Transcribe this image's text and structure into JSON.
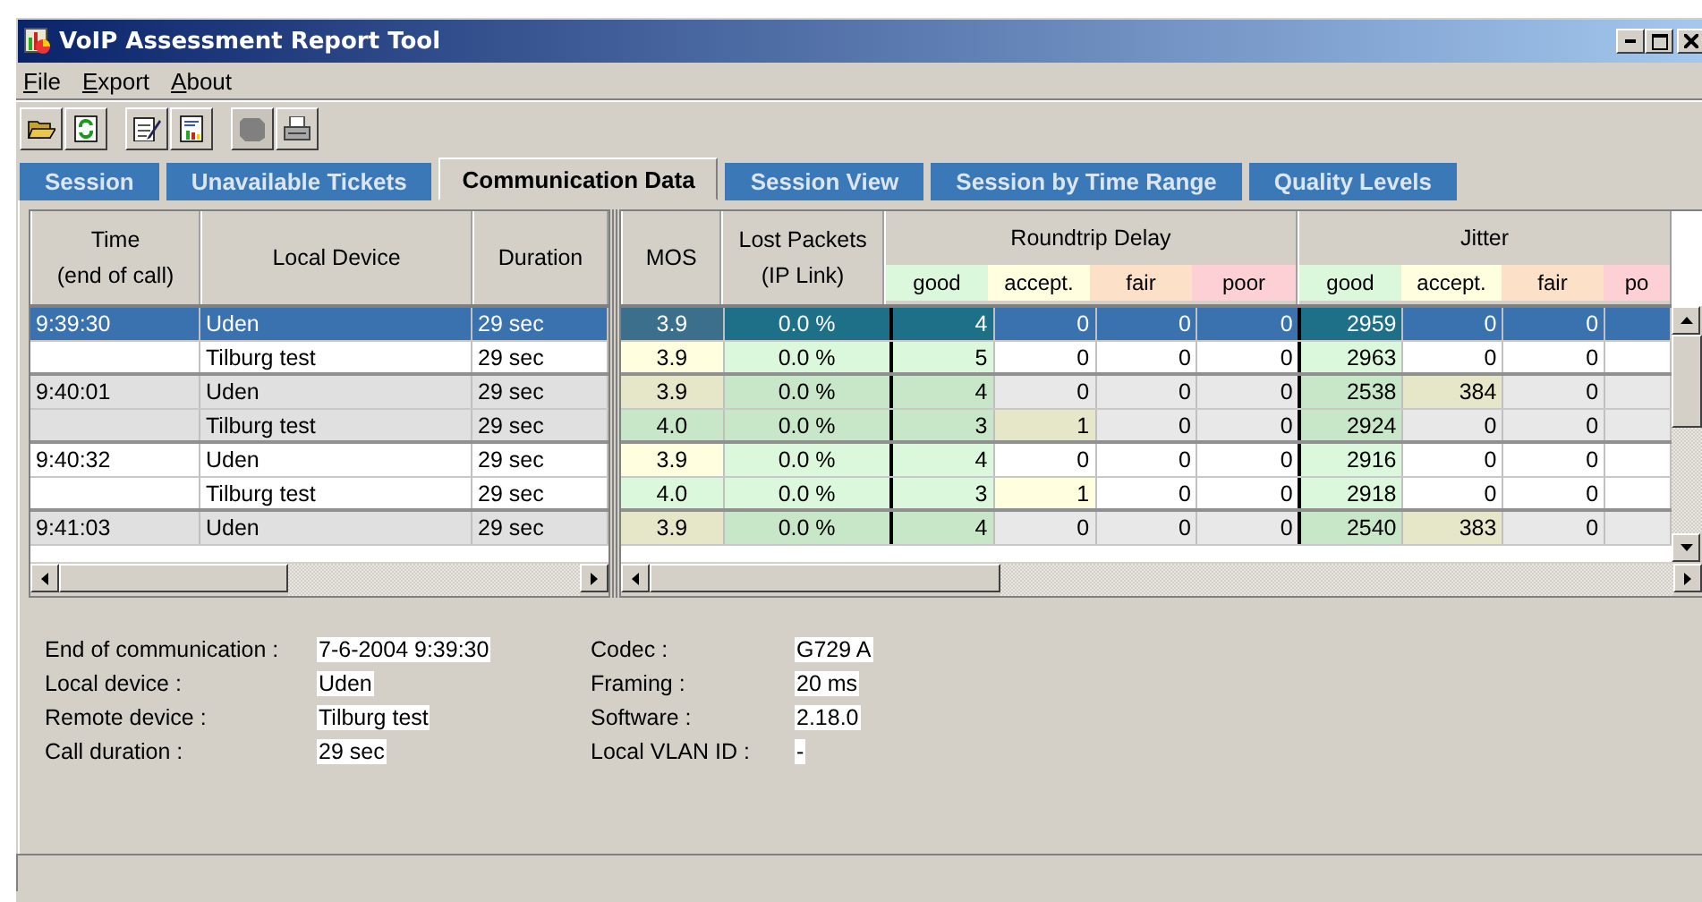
{
  "window": {
    "title": "VoIP Assessment Report Tool"
  },
  "menu": [
    "File",
    "Export",
    "About"
  ],
  "toolbar": [
    {
      "kind": "open",
      "disabled": false
    },
    {
      "kind": "refresh",
      "disabled": false
    },
    {
      "kind": "edit",
      "disabled": false
    },
    {
      "kind": "report",
      "disabled": false
    },
    {
      "kind": "blank",
      "disabled": true
    },
    {
      "kind": "print",
      "disabled": false
    }
  ],
  "tabs": [
    {
      "label": "Session",
      "selected": false
    },
    {
      "label": "Unavailable Tickets",
      "selected": false
    },
    {
      "label": "Communication Data",
      "selected": true
    },
    {
      "label": "Session View",
      "selected": false
    },
    {
      "label": "Session by Time Range",
      "selected": false
    },
    {
      "label": "Quality Levels",
      "selected": false
    }
  ],
  "table": {
    "left_columns": [
      {
        "label": "Time",
        "note": "(end of call)"
      },
      {
        "label": "Local Device"
      },
      {
        "label": "Duration"
      }
    ],
    "right_columns": [
      {
        "label": "MOS"
      },
      {
        "label": "Lost Packets",
        "note": "(IP Link)"
      }
    ],
    "groups": [
      {
        "label": "Roundtrip Delay",
        "subs": [
          {
            "label": "good",
            "color": "#dcf8dc"
          },
          {
            "label": "accept.",
            "color": "#ffffe0"
          },
          {
            "label": "fair",
            "color": "#fde0c8"
          },
          {
            "label": "poor",
            "color": "#fcd0d4"
          }
        ]
      },
      {
        "label": "Jitter",
        "subs": [
          {
            "label": "good",
            "color": "#dcf8dc"
          },
          {
            "label": "accept.",
            "color": "#ffffe0"
          },
          {
            "label": "fair",
            "color": "#fde0c8"
          },
          {
            "label": "po",
            "color": "#fcd0d4"
          }
        ]
      }
    ],
    "rows": [
      {
        "time": "9:39:30",
        "device": "Uden",
        "duration": "29 sec",
        "selected": true,
        "shaded": false,
        "mos": {
          "text": "3.9",
          "color": "#3b6f8c"
        },
        "lost": {
          "text": "0.0 %",
          "color": "#1e7088"
        },
        "delay": [
          {
            "text": "4",
            "color": "#1e7088"
          },
          {
            "text": "0",
            "color": "#3a72b0"
          },
          {
            "text": "0",
            "color": "#3a72b0"
          },
          {
            "text": "0",
            "color": "#3a72b0"
          }
        ],
        "jitter": [
          {
            "text": "2959",
            "color": "#1e7088"
          },
          {
            "text": "0",
            "color": "#3a72b0"
          },
          {
            "text": "0",
            "color": "#3a72b0"
          }
        ]
      },
      {
        "device": "Tilburg test",
        "duration": "29 sec",
        "selected": false,
        "shaded": false,
        "mos": {
          "text": "3.9",
          "color": "#ffffe0"
        },
        "lost": {
          "text": "0.0 %",
          "color": "#dcf8dc"
        },
        "delay": [
          {
            "text": "5",
            "color": "#dcf8dc"
          },
          {
            "text": "0",
            "color": "#ffffff"
          },
          {
            "text": "0",
            "color": "#ffffff"
          },
          {
            "text": "0",
            "color": "#ffffff"
          }
        ],
        "jitter": [
          {
            "text": "2963",
            "color": "#dcf8dc"
          },
          {
            "text": "0",
            "color": "#ffffff"
          },
          {
            "text": "0",
            "color": "#ffffff"
          }
        ]
      },
      {
        "time": "9:40:01",
        "device": "Uden",
        "duration": "29 sec",
        "selected": false,
        "shaded": true,
        "mos": {
          "text": "3.9",
          "color": "#e6e6c8"
        },
        "lost": {
          "text": "0.0 %",
          "color": "#c8e6c8"
        },
        "delay": [
          {
            "text": "4",
            "color": "#c8e6c8"
          },
          {
            "text": "0",
            "color": "#e8e8e8"
          },
          {
            "text": "0",
            "color": "#e8e8e8"
          },
          {
            "text": "0",
            "color": "#e8e8e8"
          }
        ],
        "jitter": [
          {
            "text": "2538",
            "color": "#c8e6c8"
          },
          {
            "text": "384",
            "color": "#e6e6c8"
          },
          {
            "text": "0",
            "color": "#e8e8e8"
          }
        ]
      },
      {
        "device": "Tilburg test",
        "duration": "29 sec",
        "selected": false,
        "shaded": true,
        "mos": {
          "text": "4.0",
          "color": "#c8e6c8"
        },
        "lost": {
          "text": "0.0 %",
          "color": "#c8e6c8"
        },
        "delay": [
          {
            "text": "3",
            "color": "#c8e6c8"
          },
          {
            "text": "1",
            "color": "#e6e6c8"
          },
          {
            "text": "0",
            "color": "#e8e8e8"
          },
          {
            "text": "0",
            "color": "#e8e8e8"
          }
        ],
        "jitter": [
          {
            "text": "2924",
            "color": "#c8e6c8"
          },
          {
            "text": "0",
            "color": "#e8e8e8"
          },
          {
            "text": "0",
            "color": "#e8e8e8"
          }
        ]
      },
      {
        "time": "9:40:32",
        "device": "Uden",
        "duration": "29 sec",
        "selected": false,
        "shaded": false,
        "mos": {
          "text": "3.9",
          "color": "#ffffe0"
        },
        "lost": {
          "text": "0.0 %",
          "color": "#dcf8dc"
        },
        "delay": [
          {
            "text": "4",
            "color": "#dcf8dc"
          },
          {
            "text": "0",
            "color": "#ffffff"
          },
          {
            "text": "0",
            "color": "#ffffff"
          },
          {
            "text": "0",
            "color": "#ffffff"
          }
        ],
        "jitter": [
          {
            "text": "2916",
            "color": "#dcf8dc"
          },
          {
            "text": "0",
            "color": "#ffffff"
          },
          {
            "text": "0",
            "color": "#ffffff"
          }
        ]
      },
      {
        "device": "Tilburg test",
        "duration": "29 sec",
        "selected": false,
        "shaded": false,
        "mos": {
          "text": "4.0",
          "color": "#dcf8dc"
        },
        "lost": {
          "text": "0.0 %",
          "color": "#dcf8dc"
        },
        "delay": [
          {
            "text": "3",
            "color": "#dcf8dc"
          },
          {
            "text": "1",
            "color": "#ffffe0"
          },
          {
            "text": "0",
            "color": "#ffffff"
          },
          {
            "text": "0",
            "color": "#ffffff"
          }
        ],
        "jitter": [
          {
            "text": "2918",
            "color": "#dcf8dc"
          },
          {
            "text": "0",
            "color": "#ffffff"
          },
          {
            "text": "0",
            "color": "#ffffff"
          }
        ]
      },
      {
        "time": "9:41:03",
        "device": "Uden",
        "duration": "29 sec",
        "selected": false,
        "shaded": true,
        "mos": {
          "text": "3.9",
          "color": "#e6e6c8"
        },
        "lost": {
          "text": "0.0 %",
          "color": "#c8e6c8"
        },
        "delay": [
          {
            "text": "4",
            "color": "#c8e6c8"
          },
          {
            "text": "0",
            "color": "#e8e8e8"
          },
          {
            "text": "0",
            "color": "#e8e8e8"
          },
          {
            "text": "0",
            "color": "#e8e8e8"
          }
        ],
        "jitter": [
          {
            "text": "2540",
            "color": "#c8e6c8"
          },
          {
            "text": "383",
            "color": "#e6e6c8"
          },
          {
            "text": "0",
            "color": "#e8e8e8"
          }
        ]
      }
    ]
  },
  "details": {
    "left": [
      {
        "label": "End of communication :",
        "value": "7-6-2004 9:39:30"
      },
      {
        "label": "Local device :",
        "value": "Uden"
      },
      {
        "label": "Remote device :",
        "value": "Tilburg test"
      },
      {
        "label": "Call duration :",
        "value": "29 sec"
      }
    ],
    "right": [
      {
        "label": "Codec :",
        "value": "G729 A"
      },
      {
        "label": "Framing :",
        "value": "20 ms"
      },
      {
        "label": "Software :",
        "value": "2.18.0"
      },
      {
        "label": "Local VLAN ID :",
        "value": "-"
      }
    ]
  }
}
